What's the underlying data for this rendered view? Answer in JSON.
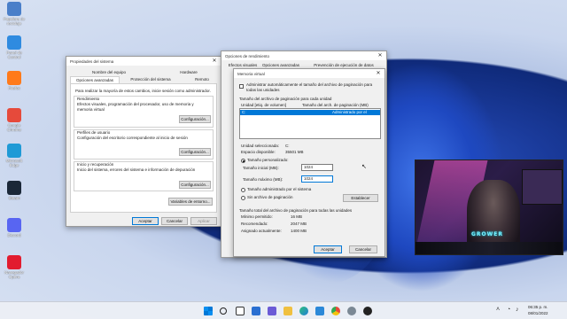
{
  "desktop_icons": [
    {
      "label": "Papelera de reciclaje",
      "icon": "recycle-bin-icon",
      "color": "#4a7fc9"
    },
    {
      "label": "Panel de Control",
      "icon": "control-panel-icon",
      "color": "#2f8be0"
    },
    {
      "label": "Firefox",
      "icon": "firefox-icon",
      "color": "#ff7a1a"
    },
    {
      "label": "Google Chrome",
      "icon": "chrome-icon",
      "color": "#e64a3b"
    },
    {
      "label": "Microsoft Edge",
      "icon": "edge-icon",
      "color": "#1f9ad6"
    },
    {
      "label": "Steam",
      "icon": "steam-icon",
      "color": "#1b2838"
    },
    {
      "label": "Discord",
      "icon": "discord-icon",
      "color": "#5865f2"
    },
    {
      "label": "Navegador Opera",
      "icon": "opera-icon",
      "color": "#e21c2f"
    }
  ],
  "system_props": {
    "title": "Propiedades del sistema",
    "tabs_top": [
      "Nombre del equipo",
      "Hardware"
    ],
    "tabs_bottom": [
      "Opciones avanzadas",
      "Protección del sistema",
      "Remoto"
    ],
    "admin_note": "Para realizar la mayoría de estos cambios, inicie sesión como administrador.",
    "perf_label": "Rendimiento",
    "perf_desc": "Efectos visuales, programación del procesador, uso de memoria y memoria virtual",
    "perf_btn": "Configuración...",
    "profiles_label": "Perfiles de usuario",
    "profiles_desc": "Configuración del escritorio correspondiente al inicio de sesión",
    "profiles_btn": "Configuración...",
    "startup_label": "Inicio y recuperación",
    "startup_desc": "Inicio del sistema, errores del sistema e información de depuración",
    "startup_btn": "Configuración...",
    "env_btn": "Variables de entorno...",
    "ok": "Aceptar",
    "cancel": "Cancelar",
    "apply": "Aplicar"
  },
  "perf_options": {
    "title": "Opciones de rendimiento",
    "tabs": [
      "Efectos visuales",
      "Opciones avanzadas",
      "Prevención de ejecución de datos"
    ],
    "ok": "Aceptar",
    "cancel": "Cancelar"
  },
  "virtual_memory": {
    "title": "Memoria virtual",
    "auto_manage": "Administrar automáticamente el tamaño del archivo de paginación para todas las unidades",
    "paging_size_label": "Tamaño del archivo de paginación para cada unidad",
    "col_drive": "Unidad [etiq. de volumen]",
    "col_size": "Tamaño del arch. de paginación (MB)",
    "row_drive": "C:",
    "row_size": "Administrado por el sistema",
    "selected_label": "Unidad seleccionada:",
    "selected_value": "C:",
    "available_label": "Espacio disponible:",
    "available_value": "35501 MB",
    "custom_size": "Tamaño personalizado:",
    "initial_label": "Tamaño inicial (MB):",
    "initial_value": "1024",
    "max_label": "Tamaño máximo (MB):",
    "max_value": "1024",
    "system_managed": "Tamaño administrado por el sistema",
    "no_paging": "Sin archivo de paginación",
    "set_btn": "Establecer",
    "total_label": "Tamaño total del archivo de paginación para todas las unidades",
    "min_label": "Mínimo permitido:",
    "min_value": "16 MB",
    "rec_label": "Recomendado:",
    "rec_value": "2047 MB",
    "cur_label": "Asignado actualmente:",
    "cur_value": "1400 MB",
    "ok": "Aceptar",
    "cancel": "Cancelar"
  },
  "taskbar": {
    "time": "06:35 p. m.",
    "date": "08/01/2022"
  },
  "webcam": {
    "logo_text": "GROWER"
  }
}
